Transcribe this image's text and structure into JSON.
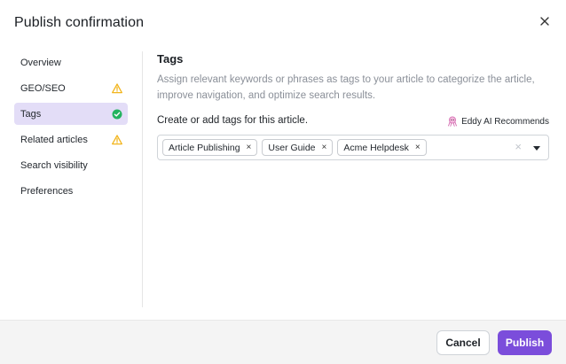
{
  "dialog": {
    "title": "Publish confirmation",
    "close_icon": "close-icon"
  },
  "sidebar": {
    "items": [
      {
        "label": "Overview",
        "status": null,
        "active": false
      },
      {
        "label": "GEO/SEO",
        "status": "warning-icon",
        "active": false
      },
      {
        "label": "Tags",
        "status": "check-circle-icon",
        "active": true
      },
      {
        "label": "Related articles",
        "status": "warning-icon",
        "active": false
      },
      {
        "label": "Search visibility",
        "status": null,
        "active": false
      },
      {
        "label": "Preferences",
        "status": null,
        "active": false
      }
    ]
  },
  "main": {
    "section_title": "Tags",
    "description": "Assign relevant keywords or phrases as tags to your article to categorize the article, improve navigation, and optimize search results.",
    "field_label": "Create or add tags for this article.",
    "ai_recommend_label": "Eddy AI Recommends",
    "ai_icon": "octopus-icon",
    "tags": [
      "Article Publishing",
      "User Guide",
      "Acme Helpdesk"
    ],
    "tag_remove_glyph": "×",
    "clear_glyph": "×"
  },
  "footer": {
    "cancel_label": "Cancel",
    "publish_label": "Publish"
  },
  "colors": {
    "accent": "#7b4ddb",
    "active_nav_bg": "#e3ddf7",
    "warning": "#f2b51d",
    "success": "#22b35e"
  }
}
